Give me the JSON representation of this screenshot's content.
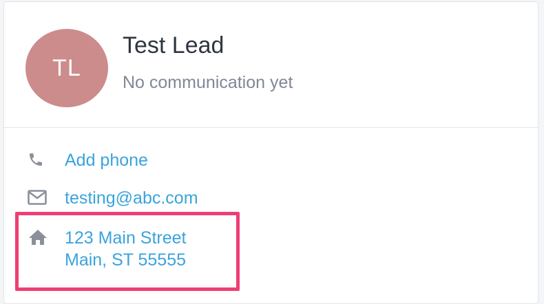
{
  "lead": {
    "initials": "TL",
    "name": "Test Lead",
    "status": "No communication yet",
    "avatar_color": "#cc8c8c"
  },
  "contact": {
    "phone_label": "Add phone",
    "email": "testing@abc.com",
    "address_line1": "123 Main Street",
    "address_line2": "Main, ST 55555",
    "link_color": "#3aa3dd"
  },
  "icons": {
    "phone": "phone-icon",
    "email": "envelope-icon",
    "address": "home-icon"
  },
  "highlight_color": "#ef3e73"
}
